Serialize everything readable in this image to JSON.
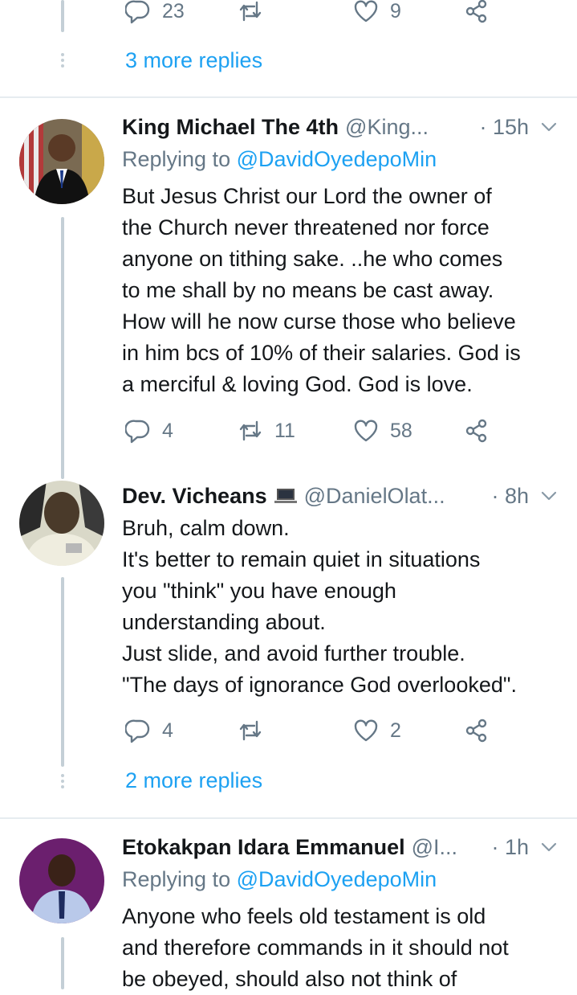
{
  "top": {
    "actions": {
      "reply_count": "23",
      "retweet_count": "",
      "like_count": "9"
    },
    "more_replies": "3 more replies"
  },
  "tweets": [
    {
      "name": "King Michael The 4th",
      "handle": "@King...",
      "time": "· 15h",
      "replying_prefix": "Replying to",
      "replying_handle": "@DavidOyedepoMin",
      "text_lines": [
        "But Jesus Christ our Lord the owner of",
        "the Church never threatened nor force",
        "anyone on tithing sake. ..he who comes",
        "to me shall by no means be cast away.",
        "How will he now curse those who believe",
        "in him bcs of 10% of their salaries. God is",
        "a merciful & loving God. God is love."
      ],
      "reply_count": "4",
      "retweet_count": "11",
      "like_count": "58"
    },
    {
      "name": "Dev. Vicheans",
      "handle": "@DanielOlat...",
      "time": "· 8h",
      "text_lines": [
        "Bruh, calm down.",
        "It's better to remain quiet in situations",
        "you \"think\" you have enough",
        "understanding about.",
        "Just slide, and avoid further trouble.",
        "\"The days of ignorance God overlooked\"."
      ],
      "reply_count": "4",
      "retweet_count": "",
      "like_count": "2",
      "more_replies": "2 more replies"
    },
    {
      "name": "Etokakpan Idara Emmanuel",
      "handle": "@I...",
      "time": "· 1h",
      "replying_prefix": "Replying to",
      "replying_handle": "@DavidOyedepoMin",
      "text_lines": [
        "Anyone who feels old testament is old",
        "and therefore commands in it should not",
        "be obeyed, should also not think of"
      ]
    }
  ],
  "colors": {
    "link": "#1da1f2",
    "muted": "#657786",
    "thread_line": "#c4cfd6",
    "divider": "#e6ecf0"
  }
}
